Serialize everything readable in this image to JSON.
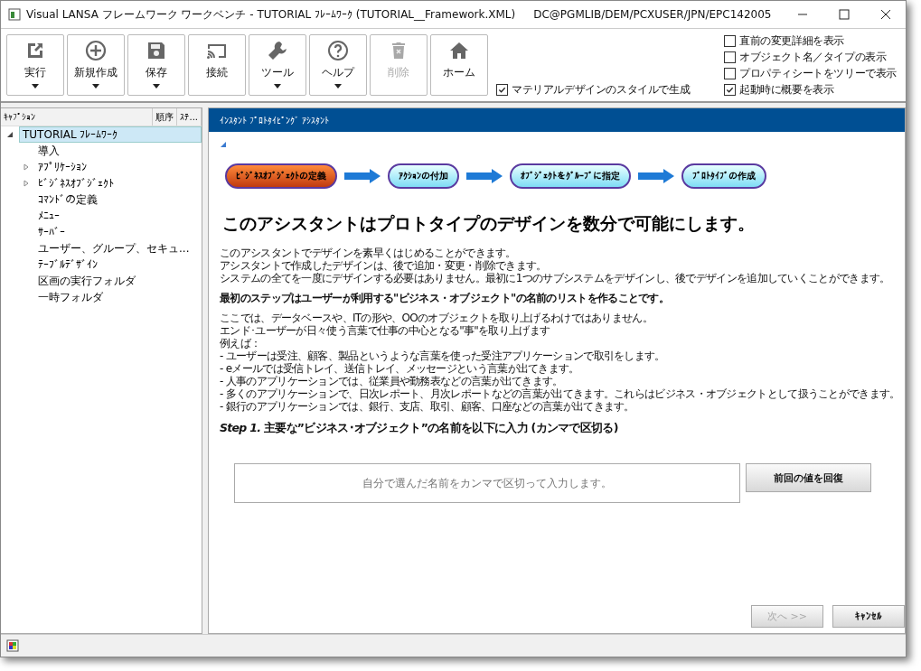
{
  "window": {
    "title": "Visual LANSA フレームワーク ワークベンチ - TUTORIAL ﾌﾚｰﾑﾜｰｸ (TUTORIAL__Framework.XML)",
    "location": "DC@PGMLIB/DEM/PCXUSER/JPN/EPC142005"
  },
  "toolbar": {
    "buttons": [
      {
        "label": "実行",
        "kind": "export",
        "has_menu": true,
        "disabled": false
      },
      {
        "label": "新規作成",
        "kind": "plus",
        "has_menu": true,
        "disabled": false
      },
      {
        "label": "保存",
        "kind": "save",
        "has_menu": true,
        "disabled": false
      },
      {
        "label": "接続",
        "kind": "cast",
        "has_menu": false,
        "disabled": false
      },
      {
        "label": "ツール",
        "kind": "wrench",
        "has_menu": true,
        "disabled": false
      },
      {
        "label": "ヘルプ",
        "kind": "help",
        "has_menu": true,
        "disabled": false
      },
      {
        "label": "削除",
        "kind": "trash",
        "has_menu": false,
        "disabled": true
      },
      {
        "label": "ホーム",
        "kind": "home",
        "has_menu": false,
        "disabled": false
      }
    ],
    "material_option": {
      "label": "マテリアルデザインのスタイルで生成",
      "checked": true
    },
    "options": [
      {
        "label": "直前の変更詳細を表示",
        "checked": false
      },
      {
        "label": "オブジェクト名／タイプの表示",
        "checked": false
      },
      {
        "label": "プロパティシートをツリーで表示",
        "checked": false
      },
      {
        "label": "起動時に概要を表示",
        "checked": true
      }
    ]
  },
  "tree": {
    "columns": [
      "ｷｬﾌﾟｼｮﾝ",
      "順序",
      "ｽﾃ..."
    ],
    "items": [
      {
        "label": "TUTORIAL ﾌﾚｰﾑﾜｰｸ",
        "expanded": true,
        "selected": true,
        "children": [
          {
            "label": "導入",
            "selected": false
          },
          {
            "label": "ｱﾌﾟﾘｹｰｼｮﾝ",
            "expanded": false,
            "selected": false
          },
          {
            "label": "ﾋﾞｼﾞﾈｽｵﾌﾞｼﾞｪｸﾄ",
            "expanded": false,
            "selected": false
          },
          {
            "label": "ｺﾏﾝﾄﾞの定義",
            "selected": false
          },
          {
            "label": "ﾒﾆｭｰ",
            "selected": false
          },
          {
            "label": "ｻｰﾊﾞｰ",
            "selected": false
          },
          {
            "label": "ユーザー、グループ、セキュ...",
            "selected": false
          },
          {
            "label": "ﾃｰﾌﾞﾙﾃﾞｻﾞｲﾝ",
            "selected": false
          },
          {
            "label": "区画の実行フォルダ",
            "selected": false
          },
          {
            "label": "一時フォルダ",
            "selected": false
          }
        ]
      }
    ]
  },
  "assistant": {
    "header": "ｲﾝｽﾀﾝﾄ ﾌﾟﾛﾄﾀｲﾋﾟﾝｸﾞ ｱｼｽﾀﾝﾄ",
    "steps": [
      {
        "label": "ﾋﾞｼﾞﾈｽｵﾌﾞｼﾞｪｸﾄの定義",
        "selected": true
      },
      {
        "label": "ｱｸｼｮﾝの付加",
        "selected": false
      },
      {
        "label": "ｵﾌﾞｼﾞｪｸﾄをｸﾞﾙｰﾌﾟに指定",
        "selected": false
      },
      {
        "label": "ﾌﾟﾛﾄﾀｲﾌﾟの作成",
        "selected": false
      }
    ],
    "heading": "このアシスタントはプロトタイプのデザインを数分で可能にします。",
    "paragraphs": [
      {
        "kind": "normal",
        "lines": [
          "このアシスタントでデザインを素早くはじめることができます。",
          "アシスタントで作成したデザインは、後で追加・変更・削除できます。",
          "システムの全てを一度にデザインする必要はありません。最初に1つのサブシステムをデザインし、後でデザインを追加していくことができます。"
        ]
      },
      {
        "kind": "bold",
        "lines": [
          "最初のステップはユーザーが利用する\"ビジネス・オブジェクト\"の名前のリストを作ることです。"
        ]
      },
      {
        "kind": "normal",
        "lines": [
          "ここでは、データベースや、ITの形や、OOのオブジェクトを取り上げるわけではありません。",
          "エンド･ユーザーが日々使う言葉で仕事の中心となる\"事\"を取り上げます",
          "例えば：",
          "- ユーザーは受注、顧客、製品というような言葉を使った受注アプリケーションで取引をします。",
          "- eメールでは受信トレイ、送信トレイ、メッセージという言葉が出てきます。",
          "- 人事のアプリケーションでは、従業員や勤務表などの言葉が出てきます。",
          "- 多くのアプリケーションで、日次レポート、月次レポートなどの言葉が出てきます。これらはビジネス・オブジェクトとして扱うことができます。",
          "- 銀行のアプリケーションでは、銀行、支店、取引、顧客、口座などの言葉が出てきます。"
        ]
      },
      {
        "kind": "step",
        "lines": [
          "*Step 1.* 主要な”ビジネス･オブジェクト”の名前を以下に入力 (カンマで区切る)"
        ]
      }
    ],
    "names_field": {
      "placeholder": "自分で選んだ名前をカンマで区切って入力します。"
    },
    "restore_button": "前回の値を回復",
    "next_button": {
      "label": "次へ >>",
      "disabled": true
    },
    "cancel_button": "ｷｬﾝｾﾙ"
  }
}
